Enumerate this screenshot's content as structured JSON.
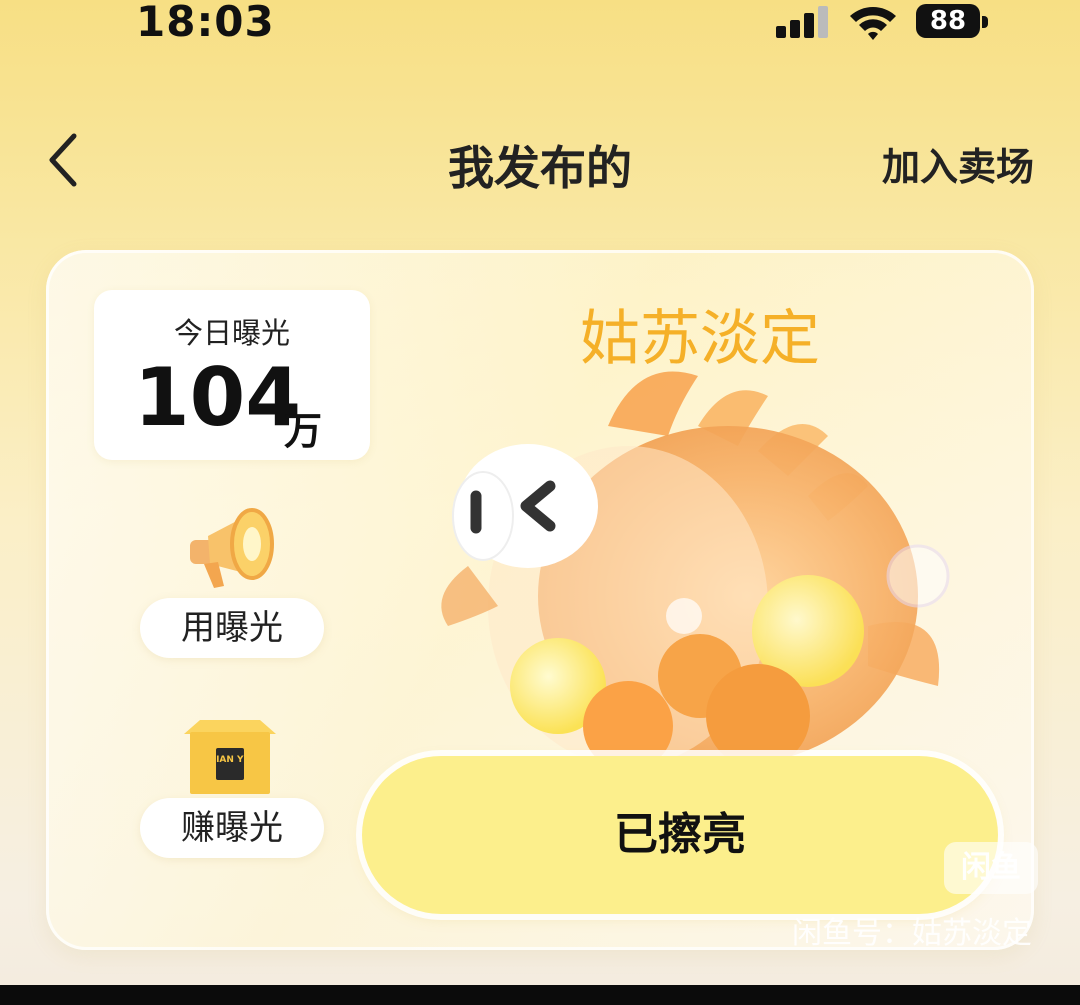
{
  "status_bar": {
    "time": "18:03",
    "battery": "88"
  },
  "nav": {
    "title": "我发布的",
    "action": "加入卖场"
  },
  "card": {
    "exposure_label": "今日曝光",
    "exposure_value": "104",
    "exposure_unit": "万",
    "use_exposure": "用曝光",
    "earn_exposure": "赚曝光",
    "box_logo_text": "XIAN YU",
    "nickname": "姑苏淡定",
    "polished_button": "已擦亮"
  },
  "watermark": {
    "logo": "闲鱼",
    "text": "闲鱼号：姑苏淡定"
  },
  "colors": {
    "accent": "#f5b028",
    "button_yellow": "#fcef8c",
    "bg_yellow": "#f7df84"
  }
}
